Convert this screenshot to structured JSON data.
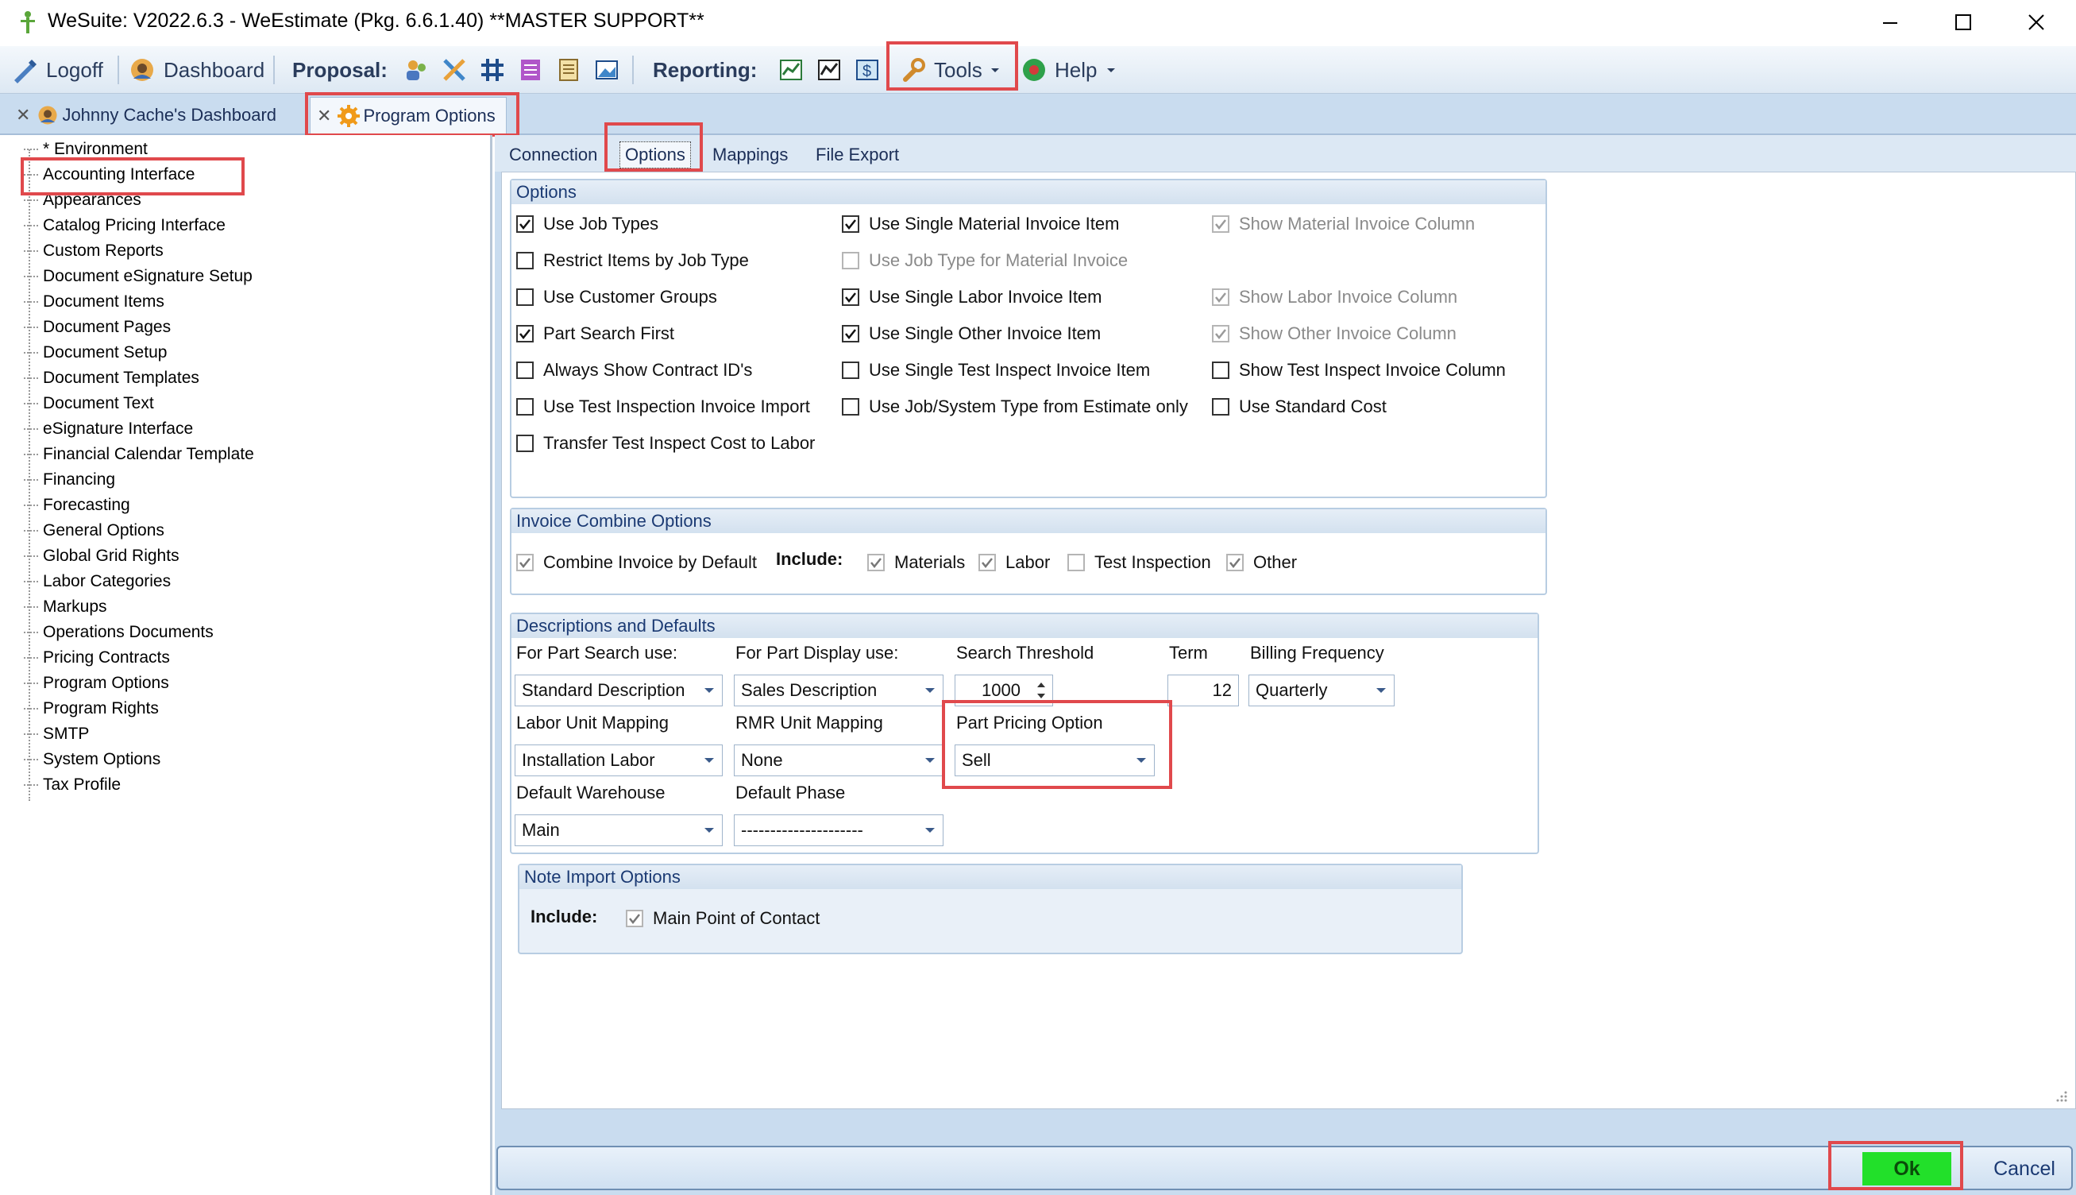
{
  "window": {
    "title": "WeSuite: V2022.6.3 - WeEstimate (Pkg. 6.6.1.40) **MASTER SUPPORT**"
  },
  "toolbar": {
    "logoff": "Logoff",
    "dashboard": "Dashboard",
    "proposal": "Proposal:",
    "reporting": "Reporting:",
    "tools": "Tools",
    "help": "Help"
  },
  "doc_tabs": [
    {
      "label": "Johnny Cache's Dashboard"
    },
    {
      "label": "Program Options"
    }
  ],
  "tree": {
    "items": [
      "* Environment",
      "Accounting Interface",
      "Appearances",
      "Catalog Pricing Interface",
      "Custom Reports",
      "Document eSignature Setup",
      "Document Items",
      "Document Pages",
      "Document Setup",
      "Document Templates",
      "Document Text",
      "eSignature Interface",
      "Financial Calendar Template",
      "Financing",
      "Forecasting",
      "General Options",
      "Global Grid Rights",
      "Labor Categories",
      "Markups",
      "Operations Documents",
      "Pricing Contracts",
      "Program Options",
      "Program Rights",
      "SMTP",
      "System Options",
      "Tax Profile"
    ]
  },
  "sub_tabs": [
    "Connection",
    "Options",
    "Mappings",
    "File Export"
  ],
  "options_group": {
    "title": "Options",
    "col1": [
      {
        "label": "Use Job Types",
        "checked": true
      },
      {
        "label": "Restrict Items by Job Type",
        "checked": false
      },
      {
        "label": "Use Customer Groups",
        "checked": false
      },
      {
        "label": "Part Search First",
        "checked": true
      },
      {
        "label": "Always Show Contract ID's",
        "checked": false
      },
      {
        "label": "Use Test Inspection Invoice Import",
        "checked": false
      },
      {
        "label": "Transfer Test Inspect Cost to Labor",
        "checked": false
      }
    ],
    "col2": [
      {
        "label": "Use Single Material Invoice Item",
        "checked": true
      },
      {
        "label": "Use Job Type for Material Invoice",
        "checked": false,
        "disabled": true
      },
      {
        "label": "Use Single Labor Invoice Item",
        "checked": true
      },
      {
        "label": "Use Single Other Invoice Item",
        "checked": true
      },
      {
        "label": "Use Single Test Inspect Invoice Item",
        "checked": false
      },
      {
        "label": "Use Job/System Type from Estimate only",
        "checked": false
      }
    ],
    "col3": [
      {
        "label": "Show Material Invoice Column",
        "checked": true,
        "disabled": true
      },
      {
        "label": "",
        "hidden": true
      },
      {
        "label": "Show Labor Invoice Column",
        "checked": true,
        "disabled": true
      },
      {
        "label": "Show Other Invoice Column",
        "checked": true,
        "disabled": true
      },
      {
        "label": "Show Test Inspect Invoice Column",
        "checked": false
      },
      {
        "label": "Use Standard Cost",
        "checked": false
      }
    ]
  },
  "invoice_combine": {
    "title": "Invoice Combine Options",
    "combine_label": "Combine Invoice by Default",
    "include_label": "Include:",
    "materials": "Materials",
    "labor": "Labor",
    "test_inspection": "Test Inspection",
    "other": "Other"
  },
  "descriptions": {
    "title": "Descriptions and Defaults",
    "part_search_label": "For Part Search use:",
    "part_search_value": "Standard Description",
    "part_display_label": "For Part Display use:",
    "part_display_value": "Sales Description",
    "search_threshold_label": "Search Threshold",
    "search_threshold_value": "1000",
    "term_label": "Term",
    "term_value": "12",
    "billing_label": "Billing Frequency",
    "billing_value": "Quarterly",
    "labor_unit_label": "Labor Unit Mapping",
    "labor_unit_value": "Installation Labor",
    "rmr_unit_label": "RMR Unit Mapping",
    "rmr_unit_value": "None",
    "pricing_label": "Part Pricing Option",
    "pricing_value": "Sell",
    "warehouse_label": "Default Warehouse",
    "warehouse_value": "Main",
    "phase_label": "Default Phase",
    "phase_value": "---------------------"
  },
  "note_import": {
    "title": "Note Import Options",
    "include_label": "Include:",
    "main_contact": "Main Point of Contact"
  },
  "buttons": {
    "ok": "Ok",
    "cancel": "Cancel"
  },
  "colors": {
    "highlight": "#e0494c",
    "ok_green": "#22e02a",
    "pane_blue": "#c9dcef"
  }
}
